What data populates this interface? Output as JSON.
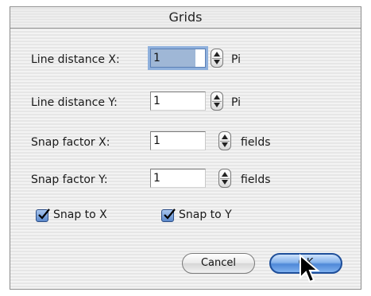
{
  "dialog": {
    "title": "Grids",
    "rows": [
      {
        "label": "Line distance X:",
        "value": "1",
        "unit": "Pi"
      },
      {
        "label": "Line distance Y:",
        "value": "1",
        "unit": "Pi"
      },
      {
        "label": "Snap factor X:",
        "value": "1",
        "unit": "fields"
      },
      {
        "label": "Snap factor Y:",
        "value": "1",
        "unit": "fields"
      }
    ],
    "checkboxes": [
      {
        "label": "Snap to X",
        "checked": true
      },
      {
        "label": "Snap to Y",
        "checked": true
      }
    ],
    "buttons": {
      "cancel_label": "Cancel",
      "ok_label": "OK"
    }
  },
  "colors": {
    "focus_ring": "#8fb0dc",
    "default_button": "#4f88d8",
    "checkbox": "#5b89cc"
  },
  "icons": {
    "stepper": "up-down-stepper-icon",
    "checkmark": "checkmark-icon",
    "cursor": "mouse-pointer-icon"
  }
}
